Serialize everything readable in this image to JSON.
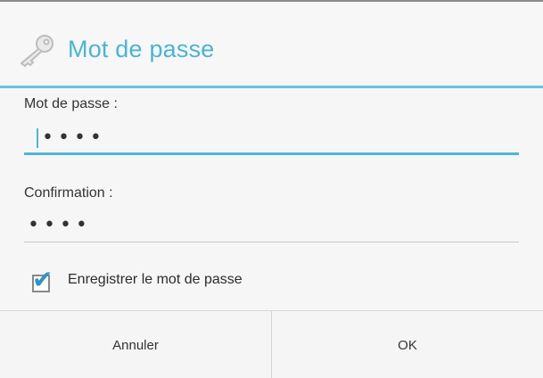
{
  "dialog": {
    "title": "Mot de passe",
    "title_icon": "key-icon",
    "accent_color": "#4ab4d6"
  },
  "form": {
    "password_label": "Mot de passe :",
    "password_value": "••••",
    "confirm_label": "Confirmation :",
    "confirm_value": "••••",
    "remember_checked": true,
    "remember_label": "Enregistrer le mot de passe"
  },
  "buttons": {
    "cancel": "Annuler",
    "ok": "OK"
  }
}
